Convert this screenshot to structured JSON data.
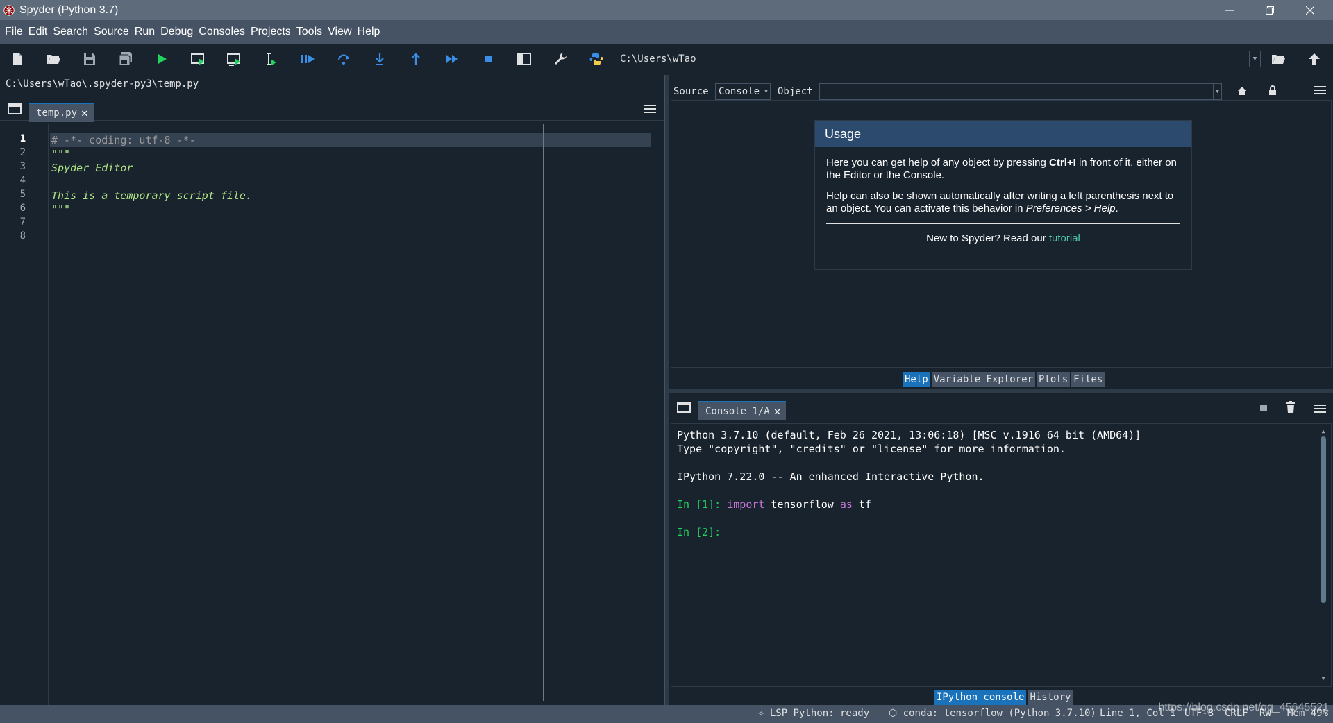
{
  "window": {
    "title": "Spyder (Python 3.7)"
  },
  "menu": [
    "File",
    "Edit",
    "Search",
    "Source",
    "Run",
    "Debug",
    "Consoles",
    "Projects",
    "Tools",
    "View",
    "Help"
  ],
  "toolbar": {
    "working_dir": "C:\\Users\\wTao"
  },
  "editor": {
    "file_path": "C:\\Users\\wTao\\.spyder-py3\\temp.py",
    "tab_label": "temp.py",
    "line_numbers": [
      "1",
      "2",
      "3",
      "4",
      "5",
      "6",
      "7",
      "8"
    ],
    "lines": [
      {
        "text": "# -*- coding: utf-8 -*-",
        "kind": "comment"
      },
      {
        "text": "\"\"\"",
        "kind": "string"
      },
      {
        "text": "Spyder Editor",
        "kind": "string"
      },
      {
        "text": "",
        "kind": "string"
      },
      {
        "text": "This is a temporary script file.",
        "kind": "string"
      },
      {
        "text": "\"\"\"",
        "kind": "string"
      },
      {
        "text": "",
        "kind": "plain"
      },
      {
        "text": "",
        "kind": "plain"
      }
    ]
  },
  "help": {
    "source_label": "Source",
    "source_value": "Console",
    "object_label": "Object",
    "object_value": "",
    "usage_title": "Usage",
    "para1_pre": "Here you can get help of any object by pressing ",
    "para1_bold": "Ctrl+I",
    "para1_post": " in front of it, either on the Editor or the Console.",
    "para2_pre": "Help can also be shown automatically after writing a left parenthesis next to an object. You can activate this behavior in ",
    "para2_em": "Preferences > Help",
    "para2_post": ".",
    "foot_pre": "New to Spyder? Read our ",
    "foot_link": "tutorial",
    "tabs": [
      "Help",
      "Variable Explorer",
      "Plots",
      "Files"
    ]
  },
  "console": {
    "tab_label": "Console 1/A",
    "line1": "Python 3.7.10 (default, Feb 26 2021, 13:06:18) [MSC v.1916 64 bit (AMD64)]",
    "line2": "Type \"copyright\", \"credits\" or \"license\" for more information.",
    "line3": "IPython 7.22.0 -- An enhanced Interactive Python.",
    "prompt1": "In [1]: ",
    "kw_import": "import",
    "mod": " tensorflow ",
    "kw_as": "as",
    "alias": " tf",
    "prompt2": "In [2]:",
    "tabs": [
      "IPython console",
      "History"
    ]
  },
  "status": {
    "lsp": "LSP Python: ready",
    "conda": "conda: tensorflow (Python 3.7.10)",
    "position": "Line 1, Col 1",
    "encoding": "UTF-8",
    "eol": "CRLF",
    "rw": "RW",
    "mem": "Mem 49%"
  },
  "watermark": "https://blog.csdn.net/qq_45645521",
  "colors": {
    "background": "#19232d",
    "menubar": "#455364",
    "accent": "#1a72bb",
    "titlebar": "#5d6b7b"
  }
}
